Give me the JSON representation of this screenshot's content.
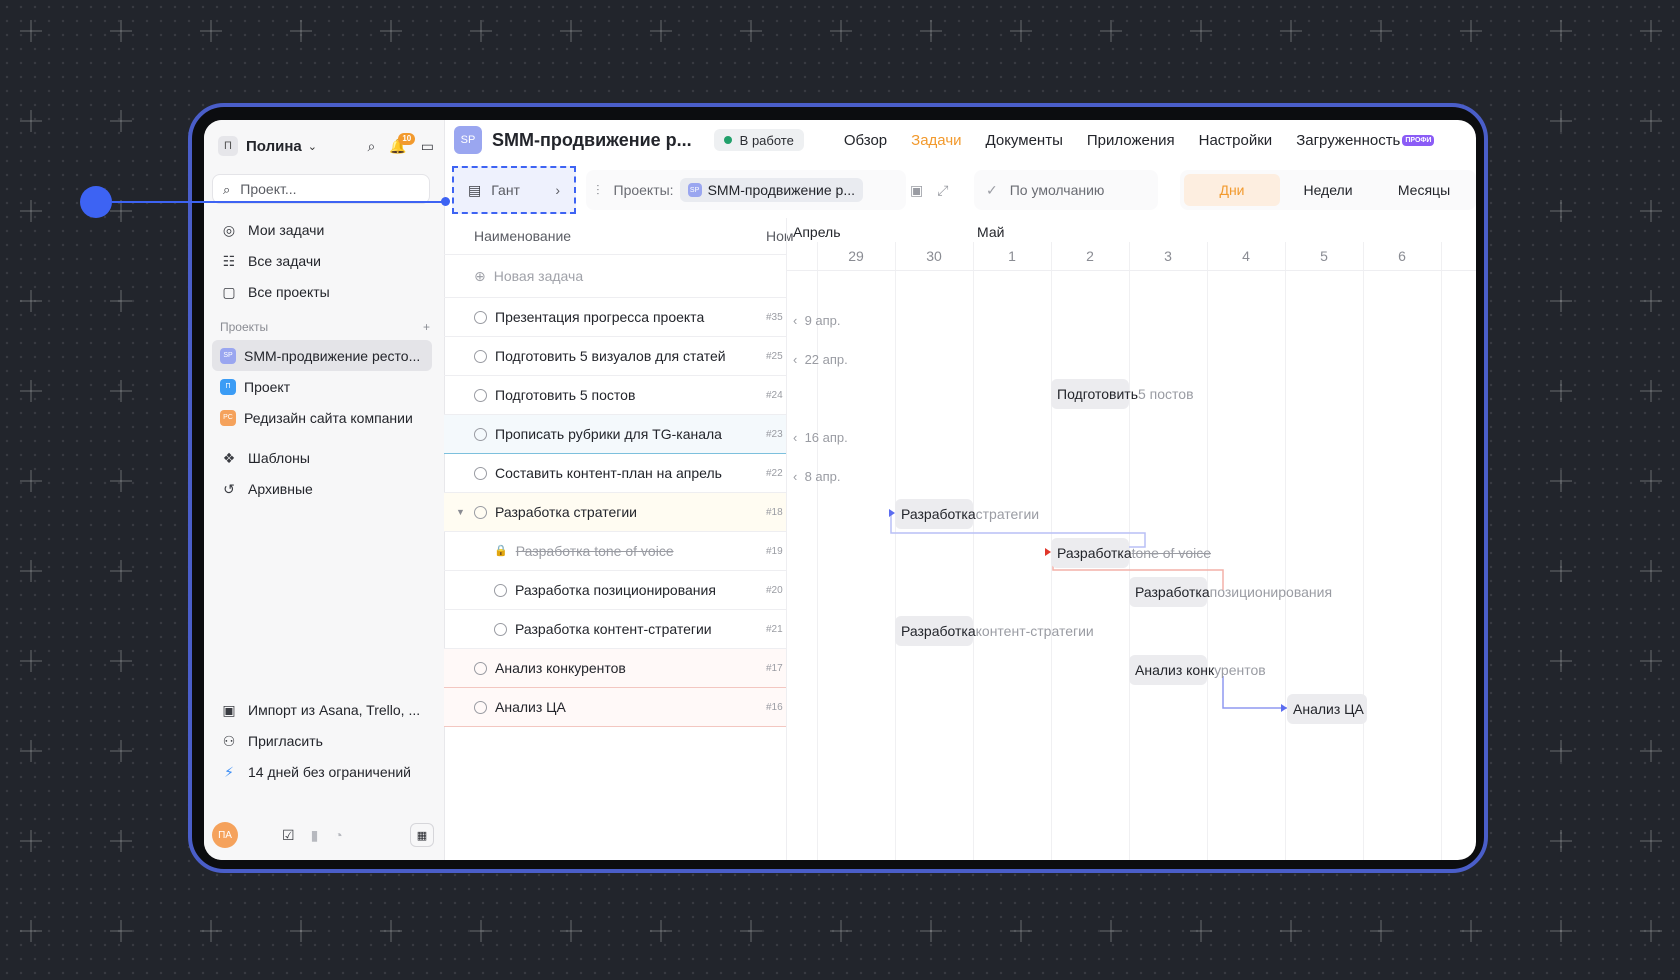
{
  "sidebar": {
    "user_initial": "П",
    "user_name": "Полина",
    "notification_count": "10",
    "search_placeholder": "Проект...",
    "nav": [
      {
        "label": "Мои задачи",
        "icon": "target-icon"
      },
      {
        "label": "Все задачи",
        "icon": "task-list-icon"
      },
      {
        "label": "Все проекты",
        "icon": "folder-icon"
      }
    ],
    "projects_section": "Проекты",
    "projects": [
      {
        "badge": "SP",
        "label": "SMM-продвижение ресто...",
        "color": "#9aa6f0",
        "active": true
      },
      {
        "badge": "П",
        "label": "Проект",
        "color": "#3b9cf5",
        "active": false
      },
      {
        "badge": "PC",
        "label": "Редизайн сайта компании",
        "color": "#f5a25c",
        "active": false
      }
    ],
    "library": [
      {
        "label": "Шаблоны",
        "icon": "templates-icon"
      },
      {
        "label": "Архивные",
        "icon": "history-icon"
      }
    ],
    "bottom": [
      {
        "label": "Импорт из Asana, Trello, ...",
        "icon": "import-icon"
      },
      {
        "label": "Пригласить",
        "icon": "invite-icon"
      },
      {
        "label": "14 дней без ограничений",
        "icon": "lightning-icon"
      }
    ],
    "footer_avatar": "ПА"
  },
  "header": {
    "badge": "SP",
    "title": "SMM-продвижение р...",
    "status": "В работе",
    "tabs": [
      "Обзор",
      "Задачи",
      "Документы",
      "Приложения",
      "Настройки",
      "Загруженность"
    ],
    "active_tab": "Задачи",
    "pro_label": "ПРОФИ"
  },
  "toolbar": {
    "view": "Гант",
    "projects_label": "Проекты:",
    "project_chip_badge": "SP",
    "project_chip": "SMM-продвижение р...",
    "sort": "По умолчанию",
    "scales": [
      "Дни",
      "Недели",
      "Месяцы"
    ],
    "active_scale": "Дни"
  },
  "list": {
    "col_name": "Наименование",
    "col_num": "Ном",
    "new_task": "Новая задача",
    "rows": [
      {
        "label": "Презентация прогресса проекта",
        "num": "#35"
      },
      {
        "label": "Подготовить 5 визуалов для статей",
        "num": "#25"
      },
      {
        "label": "Подготовить 5 постов",
        "num": "#24"
      },
      {
        "label": "Прописать рубрики для TG-канала",
        "num": "#23"
      },
      {
        "label": "Составить контент-план на апрель",
        "num": "#22"
      },
      {
        "label": "Разработка стратегии",
        "num": "#18"
      },
      {
        "label": "Разработка tone of voice",
        "num": "#19"
      },
      {
        "label": "Разработка позиционирования",
        "num": "#20"
      },
      {
        "label": "Разработка контент-стратегии",
        "num": "#21"
      },
      {
        "label": "Анализ конкурентов",
        "num": "#17"
      },
      {
        "label": "Анализ ЦА",
        "num": "#16"
      }
    ]
  },
  "gantt": {
    "months": [
      "Апрель",
      "Май"
    ],
    "days": [
      "29",
      "30",
      "1",
      "2",
      "3",
      "4",
      "5",
      "6"
    ],
    "back_labels": [
      "9 апр.",
      "22 апр.",
      "16 апр.",
      "8 апр."
    ],
    "bars": [
      {
        "a": "Подготовить",
        "b": " 5 постов"
      },
      {
        "a": "Разработка",
        "b": " стратегии"
      },
      {
        "a": "Разработка",
        "b": " tone of voice"
      },
      {
        "a": "Разработка",
        "b": " позиционирования"
      },
      {
        "a": "Разработка",
        "b": " контент-стратегии"
      },
      {
        "a": "Анализ конк",
        "b": "урентов"
      },
      {
        "a": "Анализ ЦА",
        "b": ""
      }
    ]
  }
}
